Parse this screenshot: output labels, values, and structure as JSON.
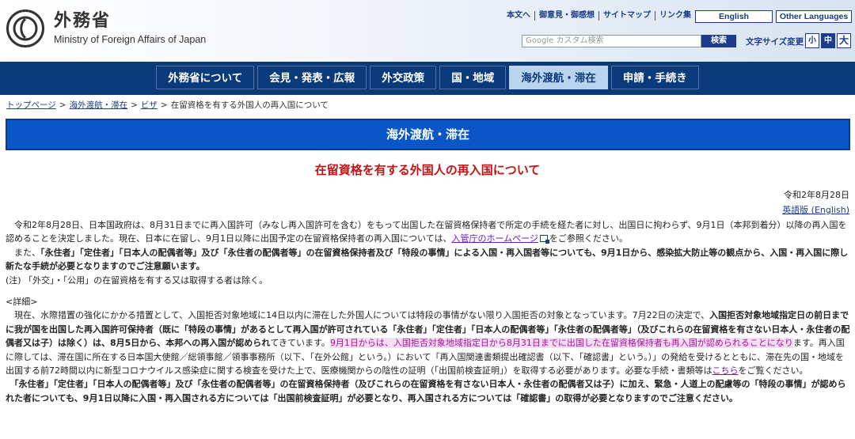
{
  "header": {
    "logo_jp": "外務省",
    "logo_en": "Ministry of Foreign Affairs of Japan",
    "util_links": [
      "本文へ",
      "御意見・御感想",
      "サイトマップ",
      "リンク集"
    ],
    "english_btn": "English",
    "other_lang_btn": "Other Languages",
    "search_placeholder": "Google カスタム検索",
    "search_btn": "検索",
    "fontsize_label": "文字サイズ変更",
    "fontsize_small": "小",
    "fontsize_medium": "中",
    "fontsize_large": "大"
  },
  "gnav": [
    {
      "label": "外務省について",
      "active": false
    },
    {
      "label": "会見・発表・広報",
      "active": false
    },
    {
      "label": "外交政策",
      "active": false
    },
    {
      "label": "国・地域",
      "active": false
    },
    {
      "label": "海外渡航・滞在",
      "active": true
    },
    {
      "label": "申請・手続き",
      "active": false
    }
  ],
  "breadcrumb": {
    "items": [
      "トップページ",
      "海外渡航・滞在",
      "ビザ"
    ],
    "current": "在留資格を有する外国人の再入国について"
  },
  "section_title": "海外渡航・滞在",
  "page_title": "在留資格を有する外国人の再入国について",
  "date": "令和2年8月28日",
  "english_link": "英語版 (English)",
  "body": {
    "p1a": "令和2年8月28日、日本国政府は、8月31日までに再入国許可（みなし再入国許可を含む）をもって出国した在留資格保持者で所定の手続を経た者に対し、出国日に拘わらず、9月1日（本邦到着分）以降の再入国を認めることを決定しました。現在、日本に在留し、9月1日以降に出国予定の在留資格保持者の再入国については、",
    "p1_link": "入管庁のホームページ",
    "p1b": "をご参照ください。",
    "p2a": "また、",
    "p2_bold": "「永住者」「定住者」「日本人の配偶者等」及び「永住者の配偶者等」の在留資格保持者及び「特段の事情」による入国・再入国者等についても、9月1日から、感染拡大防止等の観点から、入国・再入国に際し新たな手続が必要となりますのでご注意願います。",
    "note": "(注) 「外交」・「公用」の在留資格を有する又は取得する者は除く。",
    "details_heading": "<詳細>",
    "p3a": "現在、水際措置の強化にかかる措置として、入国拒否対象地域に14日以内に滞在した外国人については特段の事情がない限り入国拒否の対象となっています。7月22日の決定で、",
    "p3_bold": "入国拒否対象地域指定日の前日までに我が国を出国した再入国許可保持者（既に「特段の事情」があるとして再入国が許可されている「永住者」「定住者」「日本人の配偶者等」「永住者の配偶者等」（及びこれらの在留資格を有さない日本人・永住者の配偶者又は子）は除く）は、8月5日から、本邦への再入国が認められ",
    "p3b": "てきています。",
    "p3_highlight": "9月1日からは、入国拒否対象地域指定日から8月31日までに出国した在留資格保持者も再入国が認められることになり",
    "p3c": "ます。再入国に際しては、滞在国に所在する日本国大使館／総領事館／領事事務所（以下、「在外公館」という。）において「再入国関連書類提出確認書（以下、「確認書」という。）」の発給を受けるとともに、滞在先の国・地域を出国する前72時間以内に新型コロナウイルス感染症に関する検査を受けた上で、医療機関からの陰性の証明（「出国前検査証明」）を取得する必要があります。必要な手続・書類等は",
    "p3_link": "こちら",
    "p3d": "をご覧ください。",
    "p4_bold": "「永住者」「定住者」「日本人の配偶者等」及び「永住者の配偶者等」の在留資格保持者（及びこれらの在留資格を有さない日本人・永住者の配偶者又は子）に加え、緊急・人道上の配慮等の「特段の事情」が認められた者についても、9月1日以降に入国・再入国される方については「出国前検査証明」が必要となり、再入国される方については「確認書」の取得が必要となりますのでご注意ください。"
  }
}
